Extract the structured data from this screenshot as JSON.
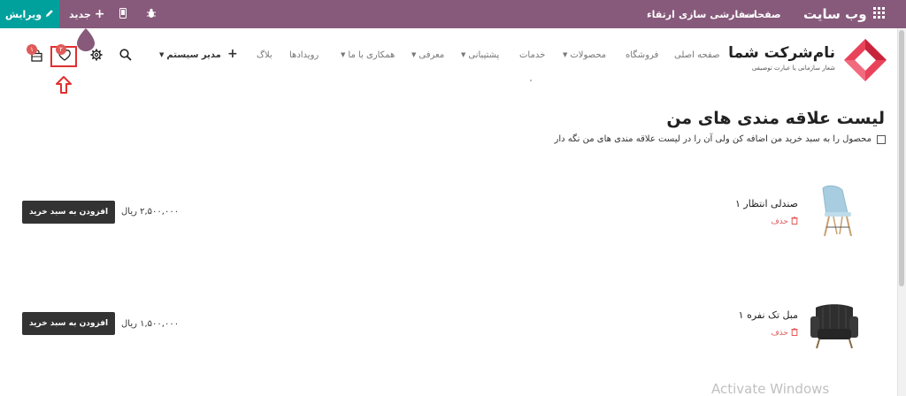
{
  "topbar": {
    "site_title": "وب سایت",
    "menu": [
      "صفحات",
      "سفارشی سازی",
      "ارتقاء"
    ],
    "new_label": "جدید",
    "edit_label": "ویرایش",
    "colors": {
      "bar": "#875a7b",
      "edit": "#00a09d"
    }
  },
  "header": {
    "brand": "نام‌شرکت شما",
    "slogan": "شعار سازمانی یا عبارت توصیفی",
    "nav": [
      {
        "label": "صفحه اصلی",
        "dropdown": false
      },
      {
        "label": "فروشگاه",
        "dropdown": false
      },
      {
        "label": "محصولات",
        "dropdown": true
      },
      {
        "label": "خدمات",
        "dropdown": false
      },
      {
        "label": "پشتیبانی",
        "dropdown": true
      },
      {
        "label": "معرفی",
        "dropdown": true
      },
      {
        "label": "همکاری با ما",
        "dropdown": true
      },
      {
        "label": "رویدادها",
        "dropdown": false
      },
      {
        "label": "بلاگ",
        "dropdown": false
      }
    ],
    "user_label": "مدیر سیستم",
    "wishlist_count": "۲",
    "cart_count": "۱"
  },
  "wishlist": {
    "title": "لیست علاقه مندی های من",
    "keep_label": "محصول را به سبد خرید من اضافه کن ولی آن را در لیست علاقه مندی های من نگه دار",
    "delete_label": "حذف",
    "add_to_cart_label": "افزودن به سبد خرید",
    "items": [
      {
        "name": "صندلی انتظار ۱",
        "price": "۲,۵۰۰,۰۰۰ ریال",
        "icon": "chair-image"
      },
      {
        "name": "مبل تک نفره ۱",
        "price": "۱,۵۰۰,۰۰۰ ریال",
        "icon": "armchair-image"
      }
    ]
  },
  "watermark": "Activate Windows"
}
